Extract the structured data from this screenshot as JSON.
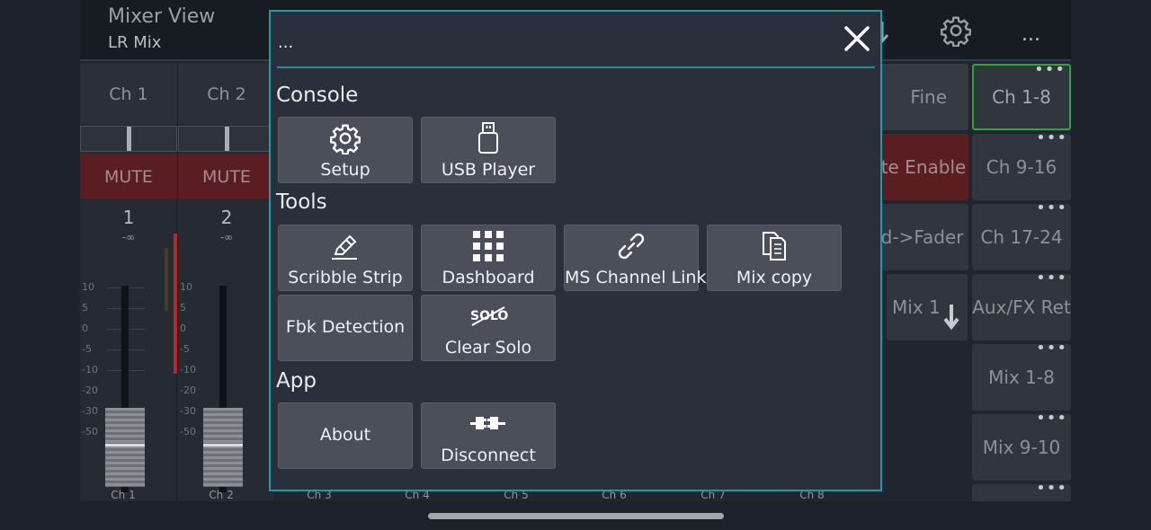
{
  "app": {
    "title": "Mixer View",
    "subtitle": "LR Mix"
  },
  "header": {
    "icons": [
      "settings-icon",
      "more-icon",
      "download-icon"
    ],
    "more_label": "..."
  },
  "channels": [
    {
      "name": "Ch 1",
      "mute": "MUTE",
      "number": "1",
      "level": "-∞",
      "footer": "Ch 1"
    },
    {
      "name": "Ch 2",
      "mute": "MUTE",
      "number": "2",
      "level": "-∞",
      "footer": "Ch 2"
    }
  ],
  "fader_scale": [
    "10",
    "5",
    "0",
    "-5",
    "-10",
    "-20",
    "-30",
    "-50"
  ],
  "bottom_channel_labels": [
    "Ch 3",
    "Ch 4",
    "Ch 5",
    "Ch 6",
    "Ch 7",
    "Ch 8"
  ],
  "right_panel": {
    "left_column": [
      {
        "label": "Fine"
      },
      {
        "label": "ute Enable"
      },
      {
        "label": "nd->Fader"
      },
      {
        "label": "Mix 1"
      }
    ],
    "banks": [
      {
        "label": "Ch 1-8",
        "dots": "•••",
        "active": true
      },
      {
        "label": "Ch 9-16",
        "dots": "•••"
      },
      {
        "label": "Ch 17-24",
        "dots": "•••"
      },
      {
        "label": "Aux/FX Ret",
        "dots": "•••"
      },
      {
        "label": "Mix 1-8",
        "dots": "•••"
      },
      {
        "label": "Mix 9-10",
        "dots": "•••"
      },
      {
        "label": "",
        "dots": "•••"
      }
    ]
  },
  "modal": {
    "title": "...",
    "sections": {
      "console": {
        "label": "Console",
        "items": [
          {
            "label": "Setup",
            "icon": "gear-icon"
          },
          {
            "label": "USB Player",
            "icon": "usb-drive-icon"
          }
        ]
      },
      "tools": {
        "label": "Tools",
        "items": [
          {
            "label": "Scribble Strip",
            "icon": "pencil-icon"
          },
          {
            "label": "Dashboard",
            "icon": "grid-icon"
          },
          {
            "label": "MS Channel Links",
            "icon": "link-icon"
          },
          {
            "label": "Mix copy",
            "icon": "copy-icon"
          },
          {
            "label": "Fbk Detection",
            "icon": ""
          },
          {
            "label": "Clear Solo",
            "icon": "solo-off-icon",
            "icon_text": "SOLO"
          }
        ]
      },
      "app": {
        "label": "App",
        "items": [
          {
            "label": "About",
            "icon": ""
          },
          {
            "label": "Disconnect",
            "icon": "disconnect-plug-icon"
          }
        ]
      }
    }
  },
  "colors": {
    "accent": "#1f9aa8",
    "active_bank": "#2fa43d",
    "mute": "#5a1e22",
    "tile": "#4a4f5a"
  }
}
